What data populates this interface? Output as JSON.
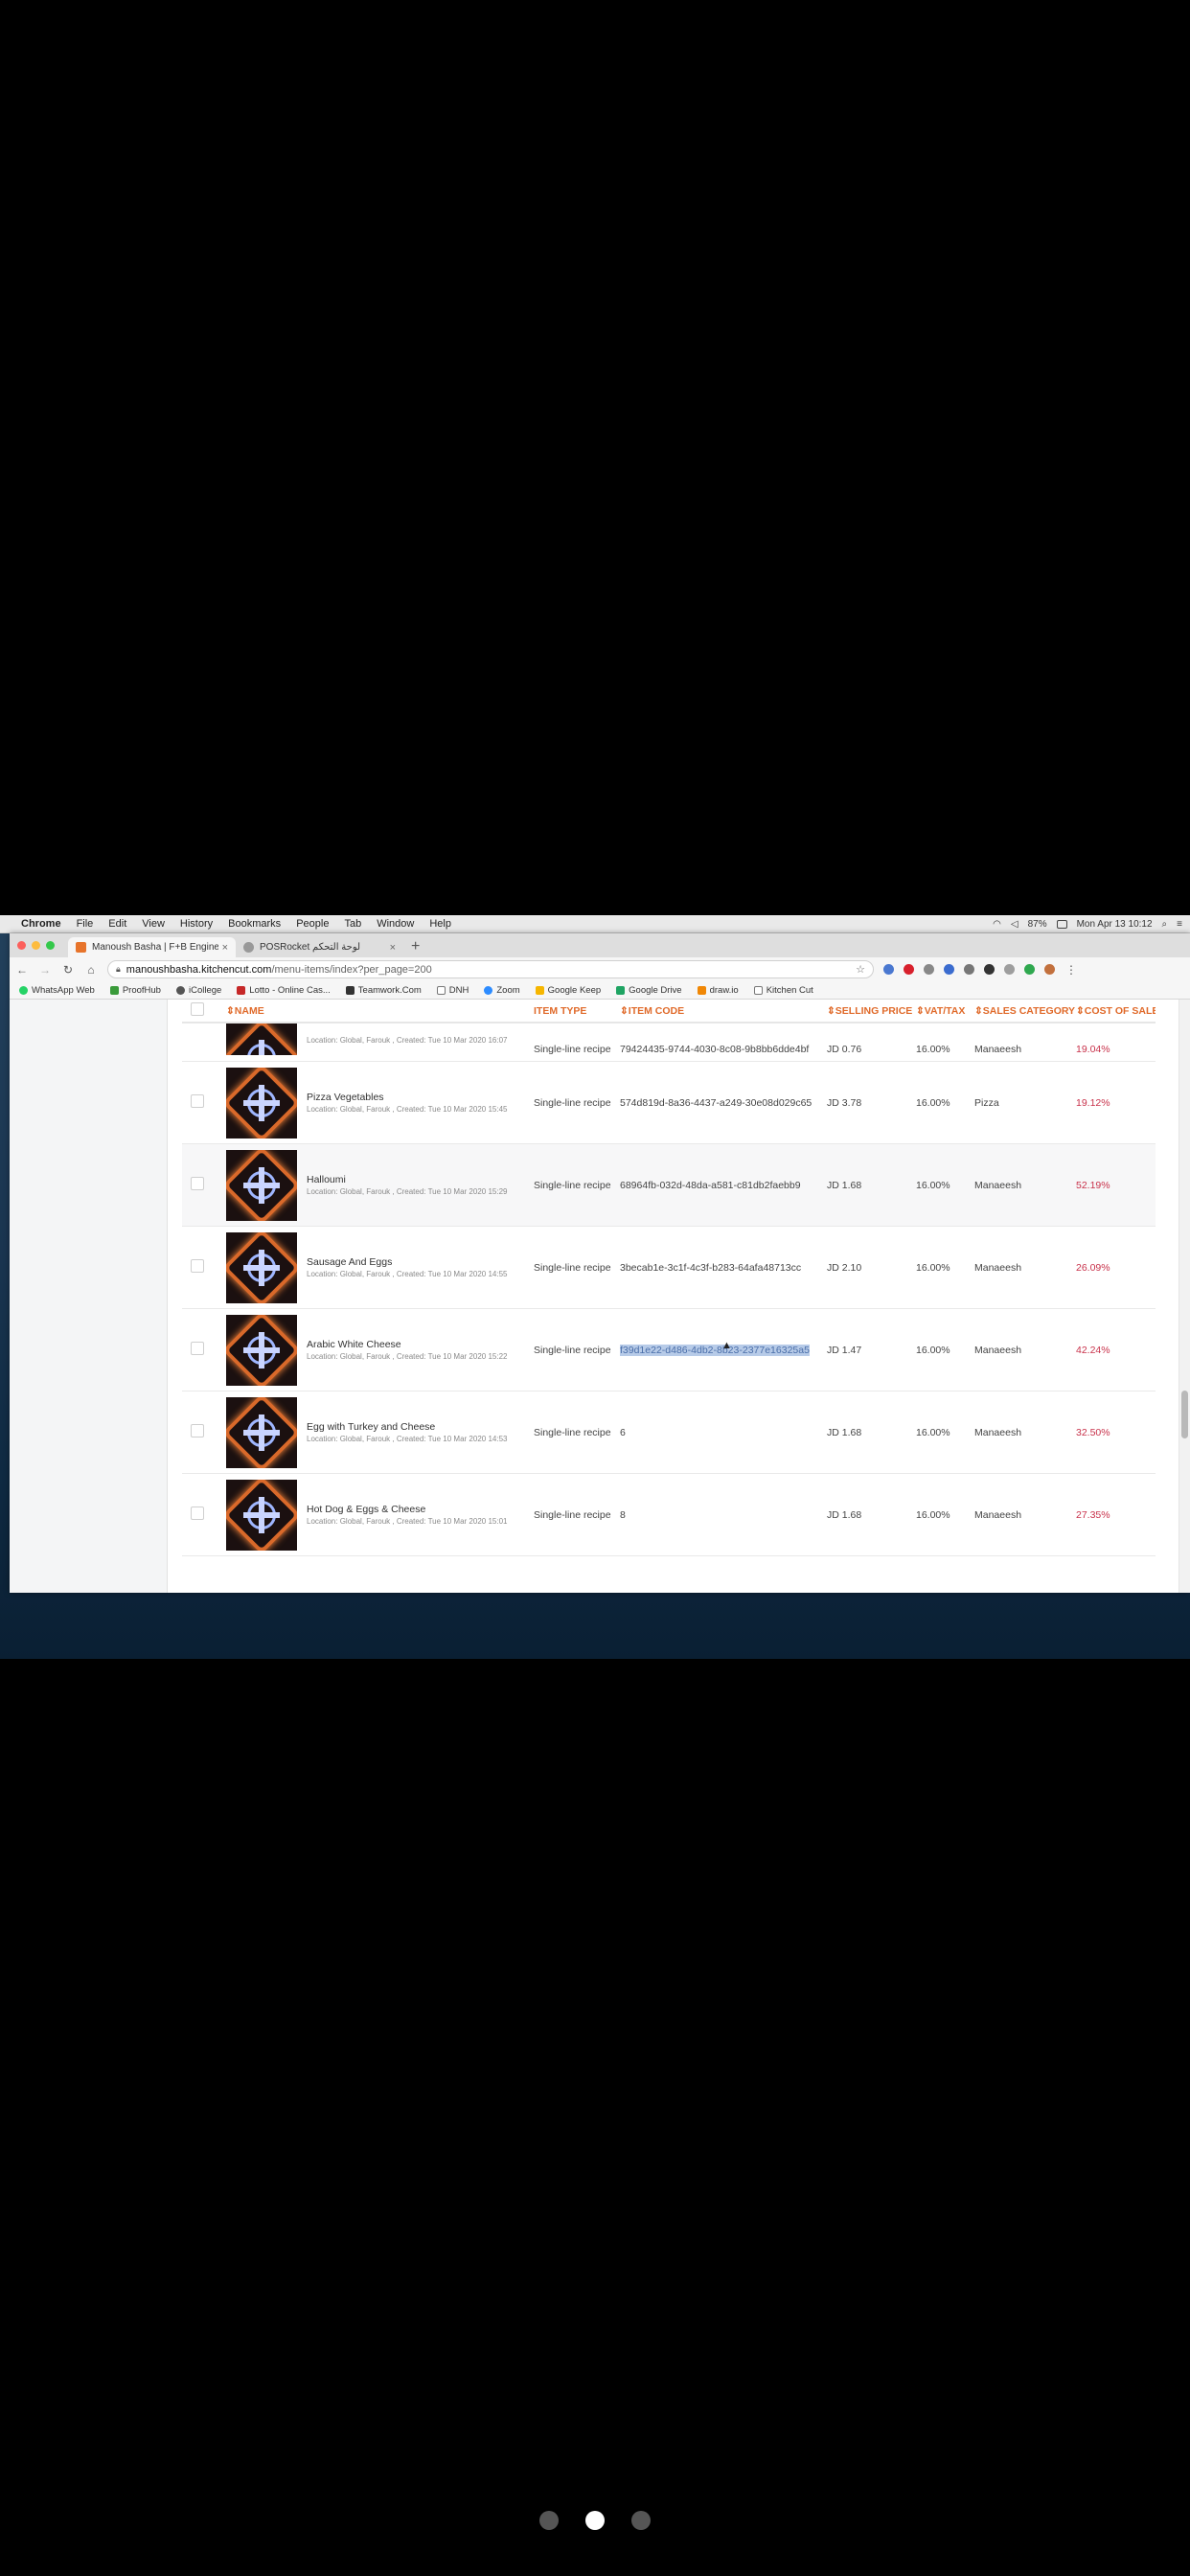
{
  "menubar": {
    "items": [
      "Chrome",
      "File",
      "Edit",
      "View",
      "History",
      "Bookmarks",
      "People",
      "Tab",
      "Window",
      "Help"
    ],
    "battery": "87%",
    "datetime": "Mon Apr 13  10:12"
  },
  "tabs": [
    {
      "title": "Manoush Basha | F+B Engine",
      "color": "#e7742b"
    },
    {
      "title": "POSRocket لوحة التحكم",
      "color": "#999999"
    }
  ],
  "address": {
    "host": "manoushbasha.kitchencut.com",
    "path": "/menu-items/index?per_page=200"
  },
  "bookmarks": [
    {
      "label": "WhatsApp Web",
      "color": "#25d366"
    },
    {
      "label": "ProofHub",
      "color": "#3a9b3a"
    },
    {
      "label": "iCollege",
      "color": "#555555"
    },
    {
      "label": "Lotto - Online Cas...",
      "color": "#c62828"
    },
    {
      "label": "Teamwork.Com",
      "color": "#333333"
    },
    {
      "label": "DNH",
      "color": "#777777"
    },
    {
      "label": "Zoom",
      "color": "#2d8cff"
    },
    {
      "label": "Google Keep",
      "color": "#f6b600"
    },
    {
      "label": "Google Drive",
      "color": "#1fa463"
    },
    {
      "label": "draw.io",
      "color": "#f08705"
    },
    {
      "label": "Kitchen Cut",
      "color": "#777777"
    }
  ],
  "table": {
    "headers": {
      "name": "⇕NAME",
      "type": "ITEM TYPE",
      "code": "⇕ITEM CODE",
      "price": "⇕SELLING PRICE",
      "vat": "⇕VAT/TAX",
      "category": "⇕SALES CATEGORY",
      "cost": "⇕COST OF SALE"
    },
    "rows": [
      {
        "name": "",
        "meta": "Location: Global, Farouk , Created: Tue 10 Mar 2020 16:07",
        "type": "Single-line recipe",
        "code": "79424435-9744-4030-8c08-9b8bb6dde4bf",
        "price": "JD 0.76",
        "vat": "16.00%",
        "category": "Manaeesh",
        "cost": "19.04%"
      },
      {
        "name": "Pizza Vegetables",
        "meta": "Location: Global, Farouk , Created: Tue 10 Mar 2020 15:45",
        "type": "Single-line recipe",
        "code": "574d819d-8a36-4437-a249-30e08d029c65",
        "price": "JD 3.78",
        "vat": "16.00%",
        "category": "Pizza",
        "cost": "19.12%"
      },
      {
        "name": "Halloumi",
        "meta": "Location: Global, Farouk , Created: Tue 10 Mar 2020 15:29",
        "type": "Single-line recipe",
        "code": "68964fb-032d-48da-a581-c81db2faebb9",
        "price": "JD 1.68",
        "vat": "16.00%",
        "category": "Manaeesh",
        "cost": "52.19%"
      },
      {
        "name": "Sausage And Eggs",
        "meta": "Location: Global, Farouk , Created: Tue 10 Mar 2020 14:55",
        "type": "Single-line recipe",
        "code": "3becab1e-3c1f-4c3f-b283-64afa48713cc",
        "price": "JD 2.10",
        "vat": "16.00%",
        "category": "Manaeesh",
        "cost": "26.09%"
      },
      {
        "name": "Arabic White Cheese",
        "meta": "Location: Global, Farouk , Created: Tue 10 Mar 2020 15:22",
        "type": "Single-line recipe",
        "code": "f39d1e22-d486-4db2-8b23-2377e16325a5",
        "price": "JD 1.47",
        "vat": "16.00%",
        "category": "Manaeesh",
        "cost": "42.24%"
      },
      {
        "name": "Egg with Turkey and Cheese",
        "meta": "Location: Global, Farouk , Created: Tue 10 Mar 2020 14:53",
        "type": "Single-line recipe",
        "code": "6",
        "price": "JD 1.68",
        "vat": "16.00%",
        "category": "Manaeesh",
        "cost": "32.50%"
      },
      {
        "name": "Hot Dog & Eggs & Cheese",
        "meta": "Location: Global, Farouk , Created: Tue 10 Mar 2020 15:01",
        "type": "Single-line recipe",
        "code": "8",
        "price": "JD 1.68",
        "vat": "16.00%",
        "category": "Manaeesh",
        "cost": "27.35%"
      }
    ]
  }
}
